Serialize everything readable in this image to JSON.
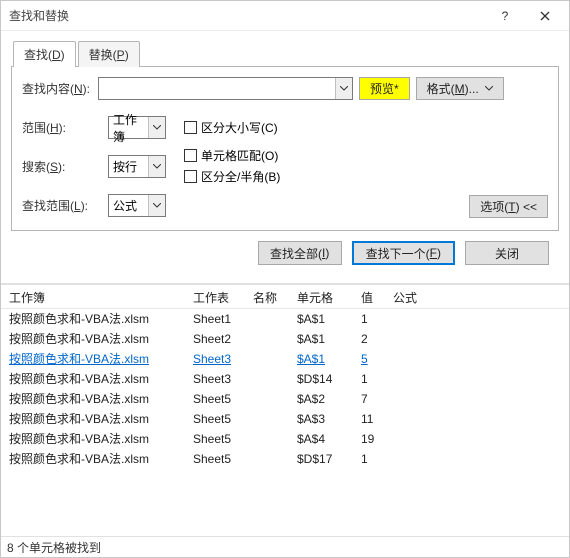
{
  "title": "查找和替换",
  "tabs": {
    "find_pre": "查找(",
    "find_mn": "D",
    "replace_pre": "替换(",
    "replace_mn": "P",
    "suf": ")"
  },
  "labels": {
    "findwhat_pre": "查找内容(",
    "findwhat_mn": "N",
    "suf": "):",
    "scope_pre": "范围(",
    "scope_mn": "H",
    "search_pre": "搜索(",
    "search_mn": "S",
    "lookin_pre": "查找范围(",
    "lookin_mn": "L"
  },
  "combo": {
    "find_value": "",
    "scope_value": "工作簿",
    "search_value": "按行",
    "lookin_value": "公式"
  },
  "check": {
    "case_pre": "区分大小写(",
    "case_mn": "C",
    "whole_pre": "单元格匹配(",
    "whole_mn": "O",
    "width_pre": "区分全/半角(",
    "width_mn": "B",
    "suf": ")"
  },
  "buttons": {
    "preview": "预览*",
    "format_pre": "格式(",
    "format_mn": "M",
    "format_suf": ")...",
    "options_pre": "选项(",
    "options_mn": "T",
    "options_suf": ")  <<",
    "findall_pre": "查找全部(",
    "findall_mn": "I",
    "findall_suf": ")",
    "findnext_pre": "查找下一个(",
    "findnext_mn": "F",
    "findnext_suf": ")",
    "close": "关闭"
  },
  "columns": {
    "workbook": "工作簿",
    "sheet": "工作表",
    "name": "名称",
    "cell": "单元格",
    "value": "值",
    "formula": "公式"
  },
  "rows": [
    {
      "wb": "按照颜色求和-VBA法.xlsm",
      "sh": "Sheet1",
      "nm": "",
      "cell": "$A$1",
      "val": "1",
      "fm": "",
      "link": false
    },
    {
      "wb": "按照颜色求和-VBA法.xlsm",
      "sh": "Sheet2",
      "nm": "",
      "cell": "$A$1",
      "val": "2",
      "fm": "",
      "link": false
    },
    {
      "wb": "按照颜色求和-VBA法.xlsm",
      "sh": "Sheet3",
      "nm": "",
      "cell": "$A$1",
      "val": "5",
      "fm": "",
      "link": true
    },
    {
      "wb": "按照颜色求和-VBA法.xlsm",
      "sh": "Sheet3",
      "nm": "",
      "cell": "$D$14",
      "val": "1",
      "fm": "",
      "link": false
    },
    {
      "wb": "按照颜色求和-VBA法.xlsm",
      "sh": "Sheet5",
      "nm": "",
      "cell": "$A$2",
      "val": "7",
      "fm": "",
      "link": false
    },
    {
      "wb": "按照颜色求和-VBA法.xlsm",
      "sh": "Sheet5",
      "nm": "",
      "cell": "$A$3",
      "val": "11",
      "fm": "",
      "link": false
    },
    {
      "wb": "按照颜色求和-VBA法.xlsm",
      "sh": "Sheet5",
      "nm": "",
      "cell": "$A$4",
      "val": "19",
      "fm": "",
      "link": false
    },
    {
      "wb": "按照颜色求和-VBA法.xlsm",
      "sh": "Sheet5",
      "nm": "",
      "cell": "$D$17",
      "val": "1",
      "fm": "",
      "link": false
    }
  ],
  "status": "8 个单元格被找到"
}
